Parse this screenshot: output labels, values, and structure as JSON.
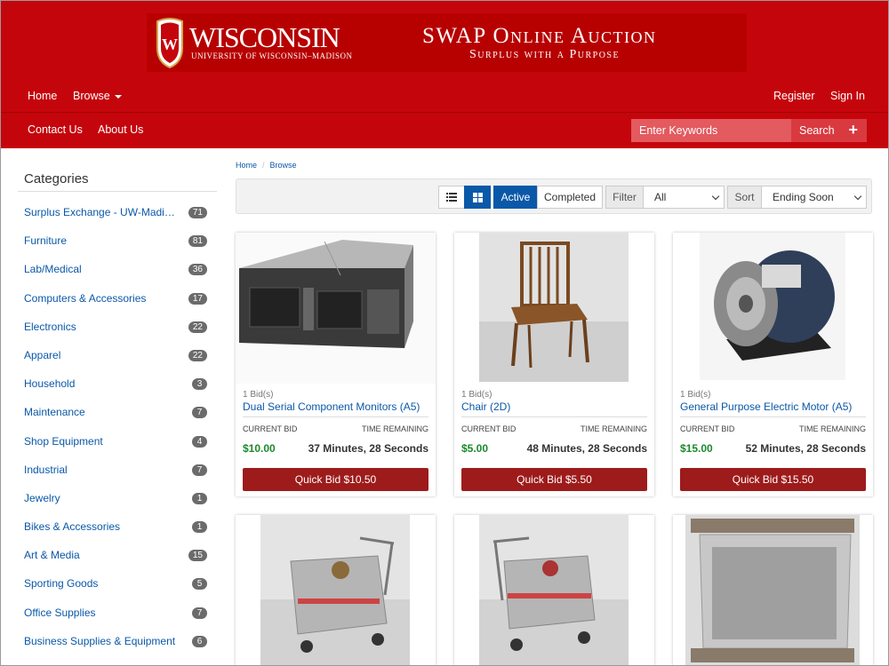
{
  "header": {
    "wordmark": "WISCONSIN",
    "submark": "UNIVERSITY OF WISCONSIN–MADISON",
    "crest_letter": "W",
    "site_title": "SWAP Online Auction",
    "site_subtitle": "Surplus with a Purpose"
  },
  "nav": {
    "home": "Home",
    "browse": "Browse",
    "register": "Register",
    "sign_in": "Sign In",
    "contact": "Contact Us",
    "about": "About Us",
    "search_placeholder": "Enter Keywords",
    "search_label": "Search"
  },
  "sidebar": {
    "title": "Categories",
    "items": [
      {
        "label": "Surplus Exchange - UW-Madison",
        "count": "71"
      },
      {
        "label": "Furniture",
        "count": "81"
      },
      {
        "label": "Lab/Medical",
        "count": "36"
      },
      {
        "label": "Computers & Accessories",
        "count": "17"
      },
      {
        "label": "Electronics",
        "count": "22"
      },
      {
        "label": "Apparel",
        "count": "22"
      },
      {
        "label": "Household",
        "count": "3"
      },
      {
        "label": "Maintenance",
        "count": "7"
      },
      {
        "label": "Shop Equipment",
        "count": "4"
      },
      {
        "label": "Industrial",
        "count": "7"
      },
      {
        "label": "Jewelry",
        "count": "1"
      },
      {
        "label": "Bikes & Accessories",
        "count": "1"
      },
      {
        "label": "Art & Media",
        "count": "15"
      },
      {
        "label": "Sporting Goods",
        "count": "5"
      },
      {
        "label": "Office Supplies",
        "count": "7"
      },
      {
        "label": "Business Supplies & Equipment",
        "count": "6"
      }
    ]
  },
  "breadcrumb": [
    "Home",
    "Browse"
  ],
  "toolbar": {
    "active": "Active",
    "completed": "Completed",
    "filter_label": "Filter",
    "filter_value": "All",
    "sort_label": "Sort",
    "sort_value": "Ending Soon",
    "list_icon": "list-view-icon",
    "grid_icon": "grid-view-icon"
  },
  "listing_labels": {
    "current_bid": "CURRENT BID",
    "time_remaining": "TIME REMAINING"
  },
  "listings": [
    {
      "bids": "1 Bid(s)",
      "title": "Dual Serial Component Monitors (A5)",
      "price": "$10.00",
      "time": "37 Minutes, 28 Seconds",
      "quick_bid": "Quick Bid $10.50"
    },
    {
      "bids": "1 Bid(s)",
      "title": "Chair (2D)",
      "price": "$5.00",
      "time": "48 Minutes, 28 Seconds",
      "quick_bid": "Quick Bid $5.50"
    },
    {
      "bids": "1 Bid(s)",
      "title": "General Purpose Electric Motor (A5)",
      "price": "$15.00",
      "time": "52 Minutes, 28 Seconds",
      "quick_bid": "Quick Bid $15.50"
    }
  ],
  "colors": {
    "brand_red": "#c5050c",
    "link_blue": "#0a58a8",
    "price_green": "#1a8a2a",
    "bid_button": "#9e1b1b"
  }
}
